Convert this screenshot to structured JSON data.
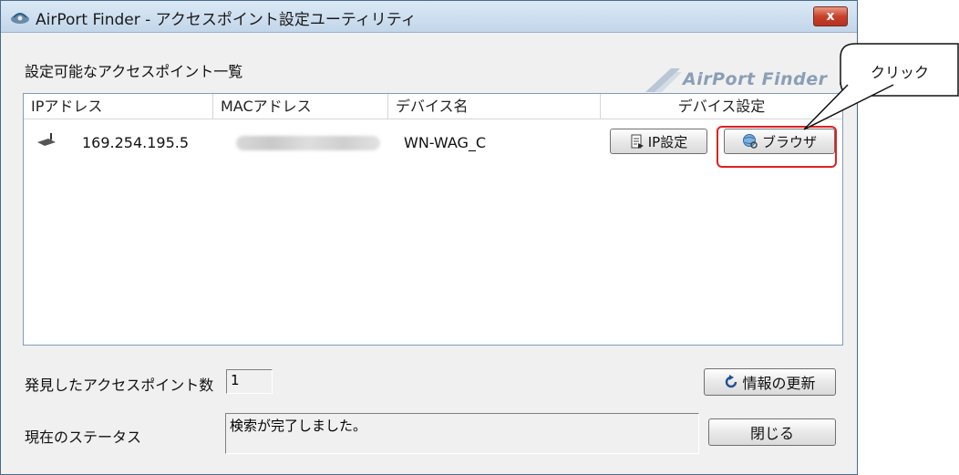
{
  "window": {
    "title": "AirPort Finder - アクセスポイント設定ユーティリティ",
    "close_label": "x"
  },
  "list": {
    "caption": "設定可能なアクセスポイント一覧",
    "logo_text": "AirPort Finder",
    "columns": [
      "IPアドレス",
      "MACアドレス",
      "デバイス名",
      "デバイス設定"
    ],
    "rows": [
      {
        "ip": "169.254.195.5",
        "mac": "",
        "device_name": "WN-WAG_C",
        "ip_settings_label": "IP設定",
        "browser_label": "ブラウザ"
      }
    ]
  },
  "footer": {
    "found_label": "発見したアクセスポイント数",
    "found_count": "1",
    "refresh_label": "情報の更新",
    "status_label": "現在のステータス",
    "status_text": "検索が完了しました。",
    "close_label": "閉じる"
  },
  "annotation": {
    "callout_text": "クリック",
    "highlight_color": "#e02020"
  }
}
